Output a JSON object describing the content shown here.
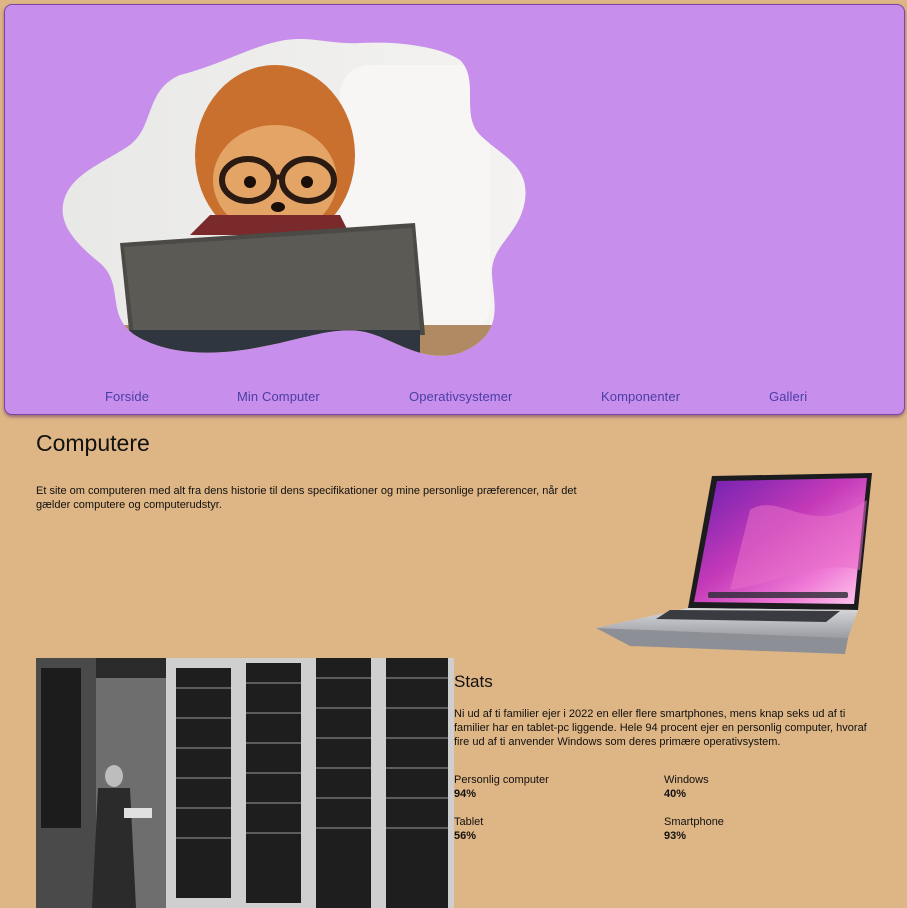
{
  "nav": {
    "items": [
      "Forside",
      "Min Computer",
      "Operativsystemer",
      "Komponenter",
      "Galleri"
    ]
  },
  "main": {
    "title": "Computere",
    "intro": "Et site om computeren med alt fra dens historie til dens specifikationer og mine personlige præferencer, når det gælder computere og computerudstyr."
  },
  "stats": {
    "title": "Stats",
    "text": "Ni ud af ti familier ejer i 2022 en eller flere smartphones, mens knap seks ud af ti familier har en tablet-pc liggende. Hele 94 procent ejer en personlig computer, hvoraf fire ud af ti anvender Windows som deres primære operativsystem.",
    "items": [
      {
        "label": "Personlig computer",
        "value": "94%"
      },
      {
        "label": "Windows",
        "value": "40%"
      },
      {
        "label": "Tablet",
        "value": "56%"
      },
      {
        "label": "Smartphone",
        "value": "93%"
      }
    ]
  },
  "colors": {
    "page_bg": "#deb584",
    "header_bg": "#c78eeb",
    "nav_link": "#4a3ea6"
  }
}
